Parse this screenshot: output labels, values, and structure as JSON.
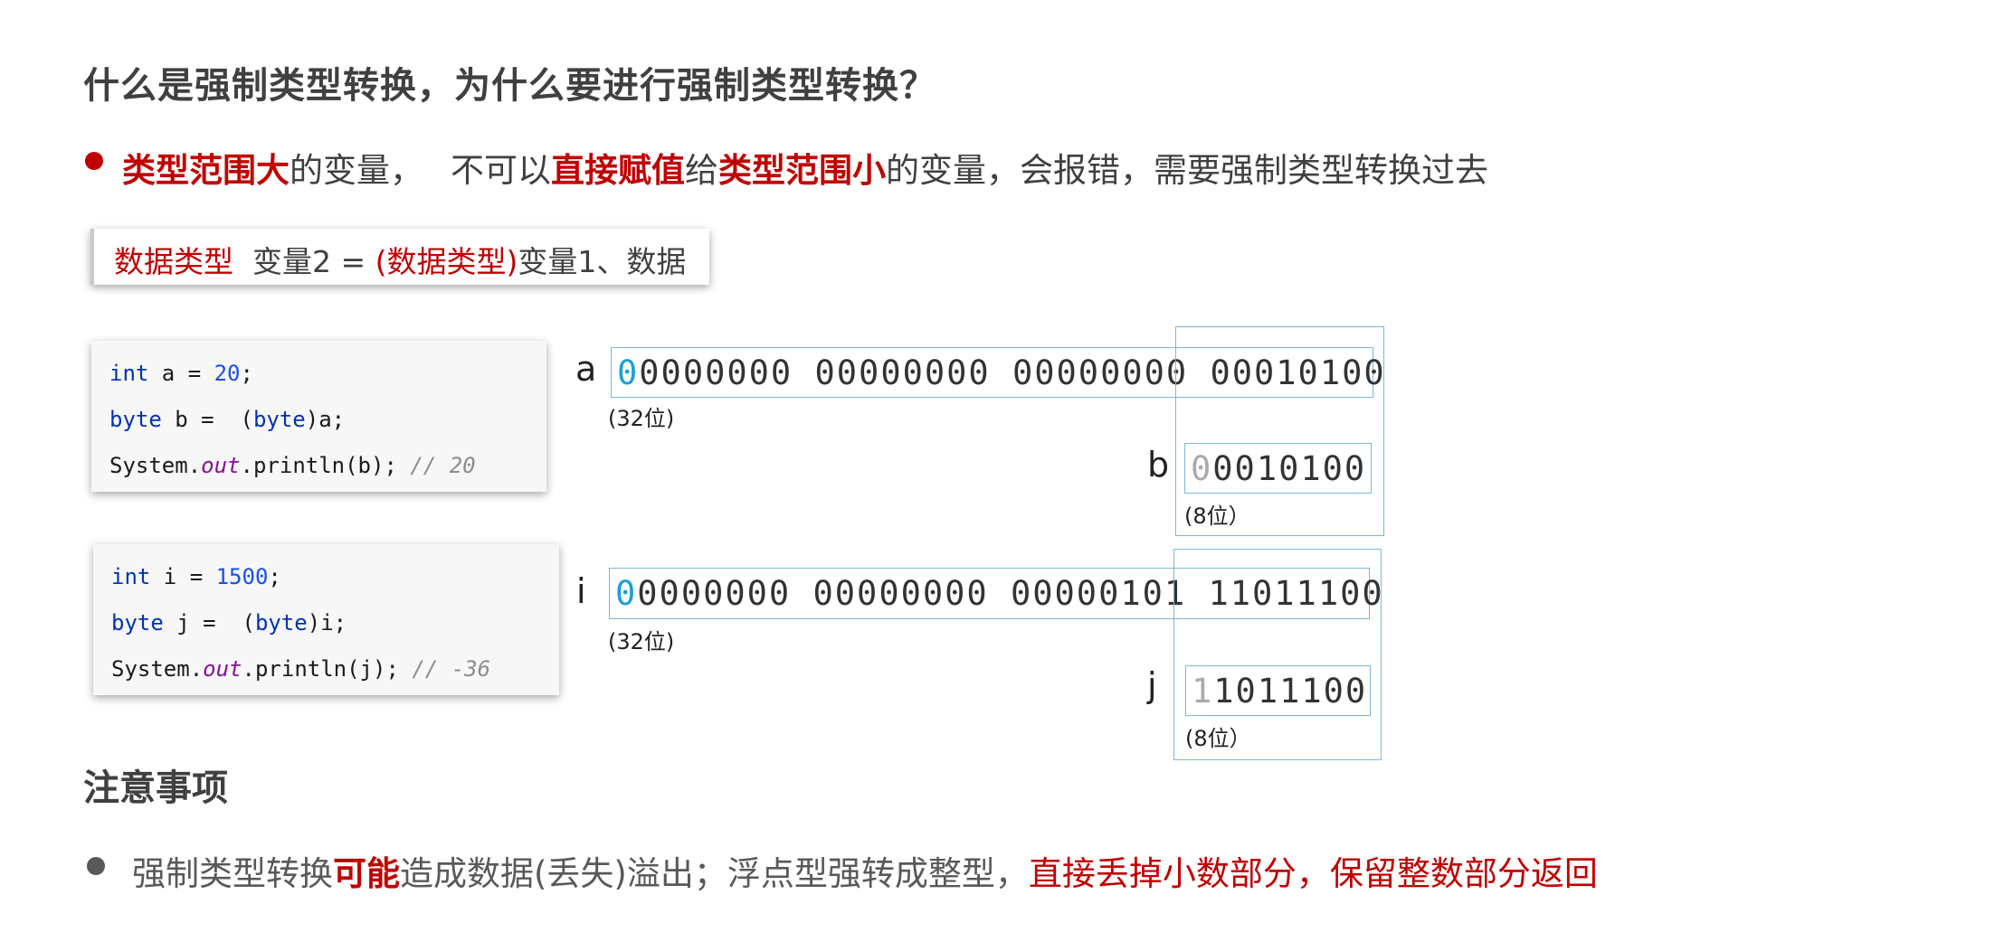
{
  "title": "什么是强制类型转换，为什么要进行强制类型转换？",
  "point": {
    "p1": "类型范围大",
    "p2": "的变量，",
    "p3": "不可以",
    "p4": "直接赋值",
    "p5": "给",
    "p6": "类型范围小",
    "p7": "的变量，会报错，需要强制类型转换过去"
  },
  "formula": {
    "type1": "数据类型",
    "mid": "变量2 = ",
    "cast": "(数据类型)",
    "rest": "变量1、数据"
  },
  "example1": {
    "line1": {
      "kw": "int",
      "mid": " a = ",
      "num": "20",
      "end": ";"
    },
    "line2": {
      "kw": "byte",
      "mid": " b =  (",
      "kw2": "byte",
      "end": ")a;"
    },
    "line3": {
      "pre": "System.",
      "fld": "out",
      "mid": ".println(b); ",
      "cmt": "// 20"
    },
    "var_a": "a",
    "a_first": "0",
    "a_rest": "0000000 00000000 00000000 00010100",
    "a_bits": "(32位)",
    "var_b": "b",
    "b_first": "0",
    "b_rest": "0010100",
    "b_bits": "(8位）"
  },
  "example2": {
    "line1": {
      "kw": "int",
      "mid": " i = ",
      "num": "1500",
      "end": ";"
    },
    "line2": {
      "kw": "byte",
      "mid": " j =  (",
      "kw2": "byte",
      "end": ")i;"
    },
    "line3": {
      "pre": "System.",
      "fld": "out",
      "mid": ".println(j); ",
      "cmt": "// -36"
    },
    "var_i": "i",
    "i_first": "0",
    "i_rest": "0000000 00000000 00000101 11011100",
    "i_bits": "(32位)",
    "var_j": "j",
    "j_first": "1",
    "j_rest": "1011100",
    "j_bits": "(8位）"
  },
  "notes": {
    "title": "注意事项",
    "n1": "强制类型转换",
    "n2": "可能",
    "n3": "造成数据(丢失)溢出；浮点型强转成整型，",
    "n4": "直接丢掉小数部分，保留整数部分返回"
  },
  "colors": {
    "accent_red": "#c00000",
    "box_blue": "#7fb6d6",
    "digit_blue": "#17a2d6"
  }
}
